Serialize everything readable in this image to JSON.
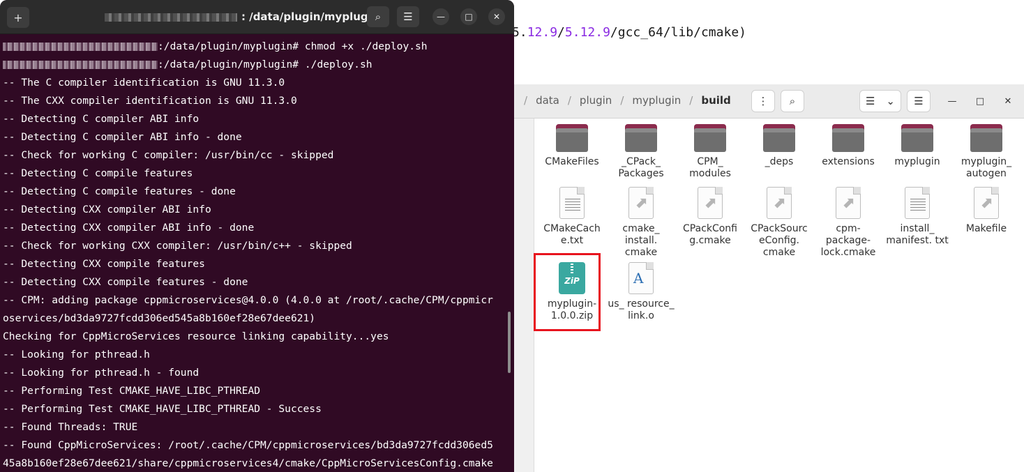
{
  "background_editor": {
    "path_parts": [
      "5.",
      "12.9",
      "/",
      "5.12.9",
      "/gcc_64/lib/cmake)"
    ]
  },
  "terminal": {
    "title_path": ": /data/plugin/myplugin",
    "lines": [
      {
        "prompt_blur": true,
        "text": ":/data/plugin/myplugin# chmod +x ./deploy.sh"
      },
      {
        "prompt_blur": true,
        "text": ":/data/plugin/myplugin# ./deploy.sh"
      },
      {
        "text": "-- The C compiler identification is GNU 11.3.0"
      },
      {
        "text": "-- The CXX compiler identification is GNU 11.3.0"
      },
      {
        "text": "-- Detecting C compiler ABI info"
      },
      {
        "text": "-- Detecting C compiler ABI info - done"
      },
      {
        "text": "-- Check for working C compiler: /usr/bin/cc - skipped"
      },
      {
        "text": "-- Detecting C compile features"
      },
      {
        "text": "-- Detecting C compile features - done"
      },
      {
        "text": "-- Detecting CXX compiler ABI info"
      },
      {
        "text": "-- Detecting CXX compiler ABI info - done"
      },
      {
        "text": "-- Check for working CXX compiler: /usr/bin/c++ - skipped"
      },
      {
        "text": "-- Detecting CXX compile features"
      },
      {
        "text": "-- Detecting CXX compile features - done"
      },
      {
        "text": "-- CPM: adding package cppmicroservices@4.0.0 (4.0.0 at /root/.cache/CPM/cppmicr"
      },
      {
        "text": "oservices/bd3da9727fcdd306ed545a8b160ef28e67dee621)"
      },
      {
        "text": "Checking for CppMicroServices resource linking capability...yes"
      },
      {
        "text": "-- Looking for pthread.h"
      },
      {
        "text": "-- Looking for pthread.h - found"
      },
      {
        "text": "-- Performing Test CMAKE_HAVE_LIBC_PTHREAD"
      },
      {
        "text": "-- Performing Test CMAKE_HAVE_LIBC_PTHREAD - Success"
      },
      {
        "text": "-- Found Threads: TRUE"
      },
      {
        "text": "-- Found CppMicroServices: /root/.cache/CPM/cppmicroservices/bd3da9727fcdd306ed5"
      },
      {
        "text": "45a8b160ef28e67dee621/share/cppmicroservices4/cmake/CppMicroServicesConfig.cmake"
      }
    ],
    "buttons": {
      "new_tab": "+",
      "search": "⌕",
      "menu": "☰",
      "minimize": "—",
      "maximize": "□",
      "close": "✕"
    }
  },
  "file_manager": {
    "breadcrumb": [
      "/",
      "data",
      "/",
      "plugin",
      "/",
      "myplugin",
      "/",
      "build"
    ],
    "buttons": {
      "more": "⋮",
      "search": "⌕",
      "list_view": "☰",
      "view_dropdown": "⌄",
      "menu": "☰",
      "minimize": "—",
      "maximize": "□",
      "close": "✕"
    },
    "items": [
      {
        "name": "CMakeFiles",
        "type": "folder"
      },
      {
        "name": "_CPack_ Packages",
        "type": "folder"
      },
      {
        "name": "CPM_ modules",
        "type": "folder"
      },
      {
        "name": "_deps",
        "type": "folder"
      },
      {
        "name": "extensions",
        "type": "folder"
      },
      {
        "name": "myplugin",
        "type": "folder"
      },
      {
        "name": "myplugin_ autogen",
        "type": "folder"
      },
      {
        "name": "CMakeCach e.txt",
        "type": "text"
      },
      {
        "name": "cmake_ install. cmake",
        "type": "cmake"
      },
      {
        "name": "CPackConfi g.cmake",
        "type": "cmake"
      },
      {
        "name": "CPackSourc eConfig. cmake",
        "type": "cmake"
      },
      {
        "name": "cpm- package- lock.cmake",
        "type": "cmake"
      },
      {
        "name": "install_ manifest. txt",
        "type": "text"
      },
      {
        "name": "Makefile",
        "type": "cmake"
      },
      {
        "name": "myplugin- 1.0.0.zip",
        "type": "zip",
        "highlighted": true
      },
      {
        "name": "us_ resource_ link.o",
        "type": "object"
      }
    ],
    "zip_icon_text": "ZiP",
    "object_icon_text": "A"
  },
  "colors": {
    "terminal_bg": "#300a24",
    "folder_tab": "#8b2b4d",
    "highlight": "#e8141e",
    "zip": "#3aa8a0"
  }
}
